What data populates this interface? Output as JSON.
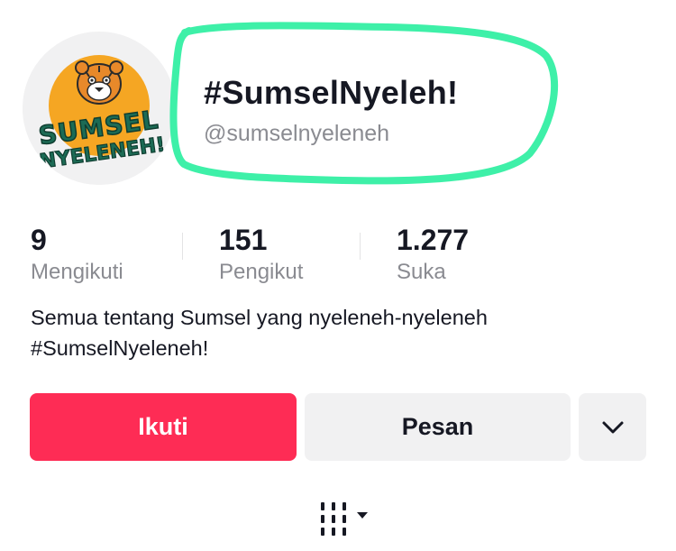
{
  "profile": {
    "display_name": "#SumselNyeleh!",
    "username": "@sumselnyeleneh",
    "avatar_logo_text": [
      "SUMSEL",
      "NYELENEH!"
    ]
  },
  "stats": [
    {
      "value": "9",
      "label": "Mengikuti"
    },
    {
      "value": "151",
      "label": "Pengikut"
    },
    {
      "value": "1.277",
      "label": "Suka"
    }
  ],
  "bio": {
    "line1": "Semua tentang Sumsel yang nyeleneh-nyeleneh",
    "line2": "#SumselNyeleneh!"
  },
  "actions": {
    "follow_label": "Ikuti",
    "message_label": "Pesan",
    "more_icon": "chevron-down-icon"
  },
  "tabs": {
    "videos_icon": "grid-columns-icon",
    "dropdown_icon": "caret-down-icon"
  },
  "colors": {
    "follow_button": "#fe2c55",
    "secondary_button": "#f1f1f2",
    "text_primary": "#161823",
    "text_secondary": "#8a8b91",
    "highlight_marker": "#3ef0a8",
    "logo_orange": "#f5a623",
    "logo_green": "#1c6b55"
  }
}
